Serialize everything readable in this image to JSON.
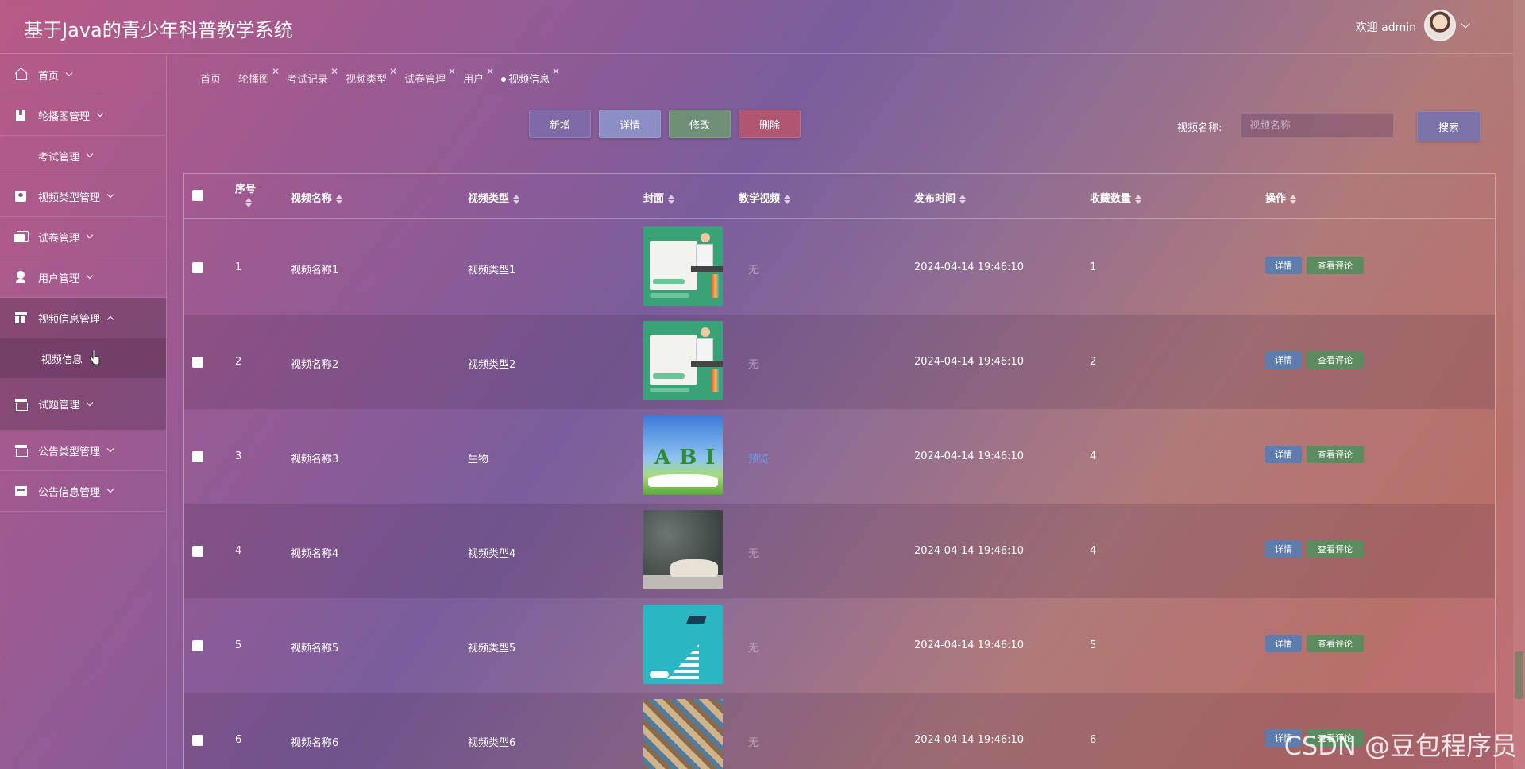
{
  "header": {
    "title": "基于Java的青少年科普教学系统",
    "welcome": "欢迎 admin"
  },
  "sidebar": {
    "items": [
      {
        "label": "首页",
        "icon": "home-icon"
      },
      {
        "label": "轮播图管理",
        "icon": "book-icon"
      },
      {
        "label": "考试管理",
        "icon": ""
      },
      {
        "label": "视频类型管理",
        "icon": "id-card-icon"
      },
      {
        "label": "试卷管理",
        "icon": "stack-icon"
      },
      {
        "label": "用户管理",
        "icon": "user-icon"
      },
      {
        "label": "视频信息管理",
        "icon": "layout-icon"
      },
      {
        "label": "视频信息",
        "icon": ""
      },
      {
        "label": "试题管理",
        "icon": "box-icon"
      },
      {
        "label": "公告类型管理",
        "icon": "box-icon"
      },
      {
        "label": "公告信息管理",
        "icon": "tray-icon"
      }
    ]
  },
  "tabs": [
    {
      "label": "首页"
    },
    {
      "label": "轮播图"
    },
    {
      "label": "考试记录"
    },
    {
      "label": "视频类型"
    },
    {
      "label": "试卷管理"
    },
    {
      "label": "用户"
    },
    {
      "label": "视频信息"
    }
  ],
  "toolbar": {
    "add_label": "新增",
    "detail_label": "详情",
    "edit_label": "修改",
    "delete_label": "删除",
    "search_label": "视频名称:",
    "search_placeholder": "视频名称",
    "search_button": "搜索"
  },
  "table": {
    "columns": [
      "序号",
      "视频名称",
      "视频类型",
      "封面",
      "教学视频",
      "发布时间",
      "收藏数量",
      "操作"
    ],
    "rows": [
      {
        "index": "1",
        "name": "视频名称1",
        "type": "视频类型1",
        "video": "无",
        "time": "2024-04-14 19:46:10",
        "favorites": "1"
      },
      {
        "index": "2",
        "name": "视频名称2",
        "type": "视频类型2",
        "video": "无",
        "time": "2024-04-14 19:46:10",
        "favorites": "2"
      },
      {
        "index": "3",
        "name": "视频名称3",
        "type": "生物",
        "video": "预览",
        "time": "2024-04-14 19:46:10",
        "favorites": "4"
      },
      {
        "index": "4",
        "name": "视频名称4",
        "type": "视频类型4",
        "video": "无",
        "time": "2024-04-14 19:46:10",
        "favorites": "4"
      },
      {
        "index": "5",
        "name": "视频名称5",
        "type": "视频类型5",
        "video": "无",
        "time": "2024-04-14 19:46:10",
        "favorites": "5"
      },
      {
        "index": "6",
        "name": "视频名称6",
        "type": "视频类型6",
        "video": "无",
        "time": "2024-04-14 19:46:10",
        "favorites": "6"
      }
    ],
    "op_detail": "详情",
    "op_comment": "查看评论"
  },
  "watermark": "CSDN @豆包程序员"
}
